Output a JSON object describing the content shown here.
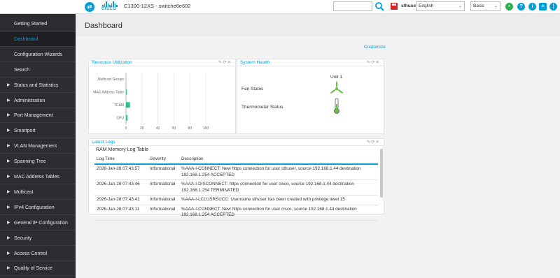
{
  "header": {
    "device_name": "C1300-12XS - switche6e602",
    "logo_text": "CISCO",
    "user": "sthuser",
    "language": "English",
    "mode": "Basic"
  },
  "sidebar": {
    "items": [
      {
        "label": "Getting Started",
        "expandable": false
      },
      {
        "label": "Dashboard",
        "expandable": false,
        "active": true
      },
      {
        "label": "Configuration Wizards",
        "expandable": false
      },
      {
        "label": "Search",
        "expandable": false
      },
      {
        "label": "Status and Statistics",
        "expandable": true
      },
      {
        "label": "Administration",
        "expandable": true
      },
      {
        "label": "Port Management",
        "expandable": true
      },
      {
        "label": "Smartport",
        "expandable": true
      },
      {
        "label": "VLAN Management",
        "expandable": true
      },
      {
        "label": "Spanning Tree",
        "expandable": true
      },
      {
        "label": "MAC Address Tables",
        "expandable": true
      },
      {
        "label": "Multicast",
        "expandable": true
      },
      {
        "label": "IPv4 Configuration",
        "expandable": true
      },
      {
        "label": "General IP Configuration",
        "expandable": true
      },
      {
        "label": "Security",
        "expandable": true
      },
      {
        "label": "Access Control",
        "expandable": true
      },
      {
        "label": "Quality of Service",
        "expandable": true
      }
    ]
  },
  "main": {
    "title": "Dashboard",
    "customize": "Customize"
  },
  "resource_panel": {
    "title": "Resource Utilization",
    "tools": "✎⟳✕",
    "chart_data": {
      "type": "bar",
      "orientation": "horizontal",
      "categories": [
        "Multicast Groups",
        "MAC Address Table",
        "TCAM",
        "CPU"
      ],
      "values": [
        0,
        1,
        5,
        2
      ],
      "xlim": [
        0,
        100
      ],
      "x_ticks": [
        "0",
        "20",
        "40",
        "60",
        "80",
        "100"
      ],
      "bar_color": "#2bc48a"
    }
  },
  "health_panel": {
    "title": "System Health",
    "tools": "✎⟳✕",
    "unit_label": "Unit 1",
    "fan_label": "Fan Status",
    "thermo_label": "Thermometer Status",
    "status_color": "#6abf4b"
  },
  "logs_panel": {
    "title": "Latest Logs",
    "tools": "✎⟳✕",
    "table_title": "RAM Memory Log Table",
    "columns": [
      "Log Time",
      "Severity",
      "Description"
    ],
    "rows": [
      {
        "time": "2026-Jan-28 07:43:57",
        "severity": "Informational",
        "description": "%AAA-I-CONNECT: New https connection for user sthuser, source 192.168.1.44 destination 192.168.1.254 ACCEPTED"
      },
      {
        "time": "2026-Jan-28 07:43:46",
        "severity": "Informational",
        "description": "%AAA-I-DISCONNECT: https connection for user cisco, source 192.168.1.44 destination 192.168.1.254 TERMINATED"
      },
      {
        "time": "2026-Jan-28 07:43:41",
        "severity": "Informational",
        "description": "%AAA-I-LCLUSRSUCC: Username sthuser has been created with privilege level 15"
      },
      {
        "time": "2026-Jan-28 07:43:11",
        "severity": "Informational",
        "description": "%AAA-I-CONNECT: New https connection for user cisco, source 192.168.1.44 destination 192.168.1.254 ACCEPTED"
      }
    ]
  }
}
